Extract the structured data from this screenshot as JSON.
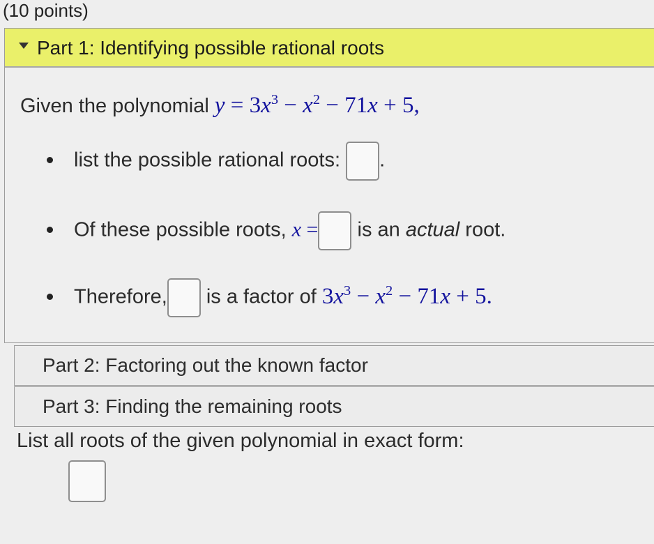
{
  "header": {
    "points": "(10 points)"
  },
  "part1": {
    "title": "Part 1: Identifying possible rational roots",
    "given_prefix": "Given the polynomial",
    "bullet1_text": "list the possible rational roots:",
    "bullet1_suffix": ".",
    "bullet2_text": "Of these possible roots,",
    "bullet2_suffix_a": "is an ",
    "bullet2_suffix_em": "actual",
    "bullet2_suffix_b": " root.",
    "bullet3_prefix": "Therefore,",
    "bullet3_middle": "is a factor of"
  },
  "part2": {
    "title": "Part 2: Factoring out the known factor"
  },
  "part3": {
    "title": "Part 3: Finding the remaining roots"
  },
  "final": {
    "prompt": "List all roots of the given polynomial in exact form:"
  },
  "colors": {
    "header_highlight": "#eaf06a",
    "math_blue": "#14149e"
  },
  "icons": {
    "collapse": "caret-down-icon"
  }
}
